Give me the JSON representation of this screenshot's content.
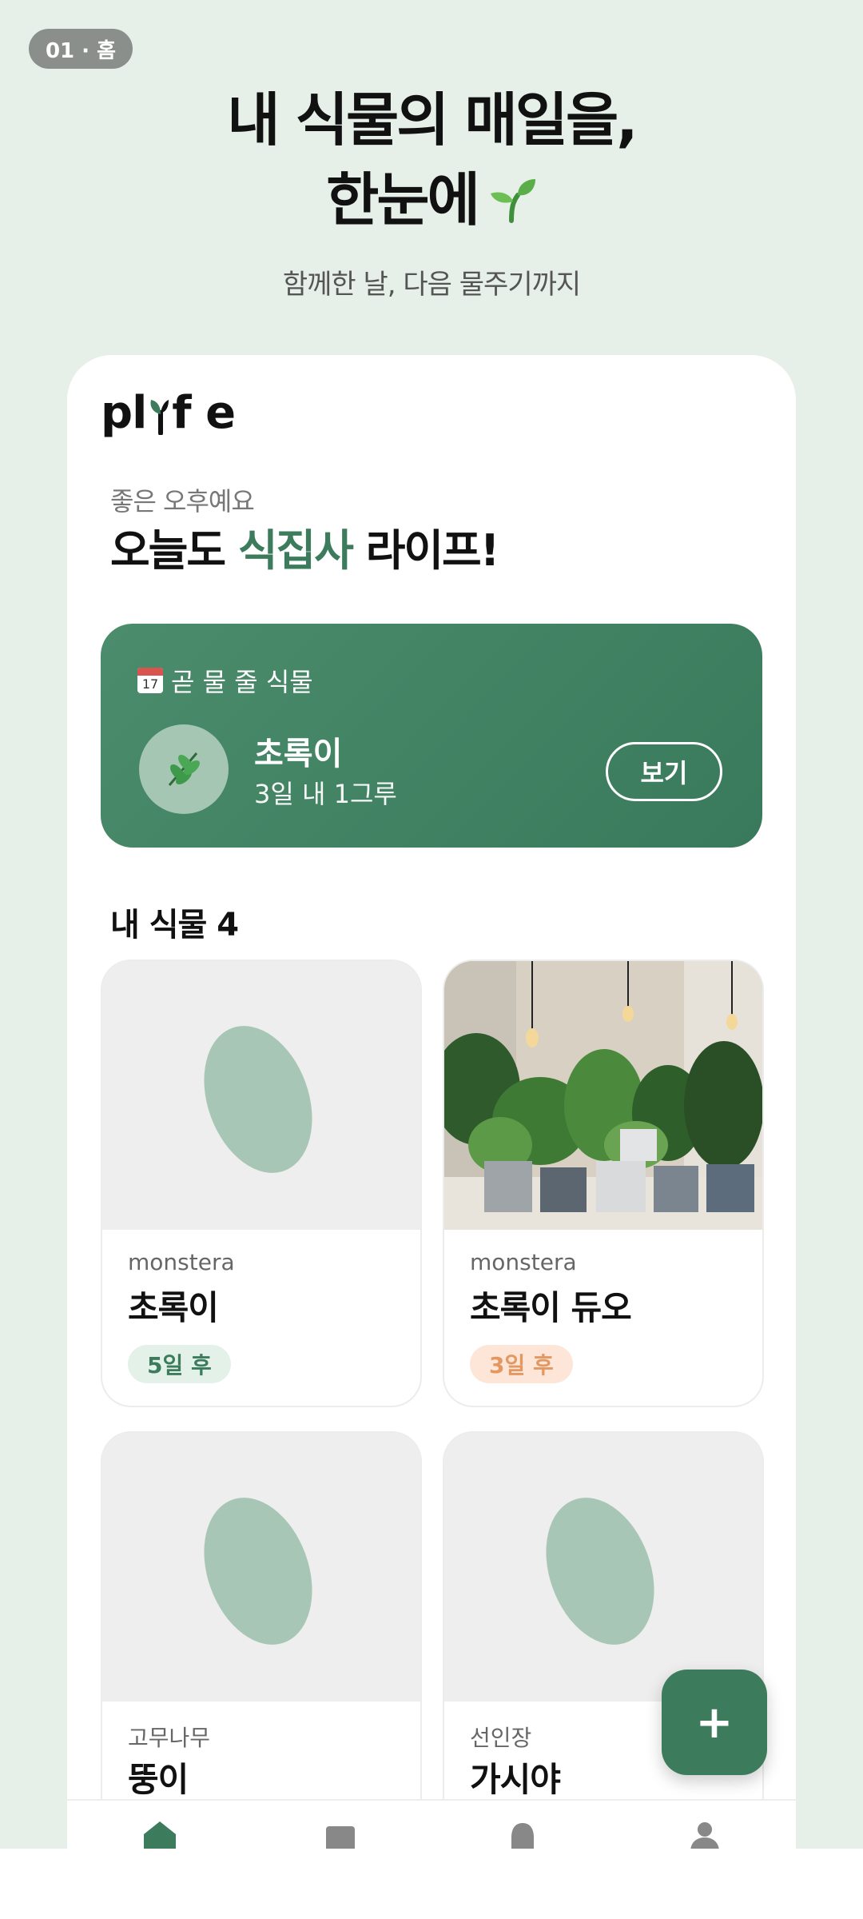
{
  "step_badge": "01 · 홈",
  "hero": {
    "title_line1": "내 식물의 매일을,",
    "title_line2": "한눈에",
    "subtitle": "함께한 날, 다음 물주기까지"
  },
  "app": {
    "logo": {
      "part1": "pl",
      "part2": "f e"
    },
    "greeting": "좋은 오후예요",
    "headline": {
      "before": "오늘도 ",
      "accent": "식집사",
      "after": " 라이프!"
    },
    "water_card": {
      "title": "곧 물 줄 식물",
      "calendar_number": "17",
      "plant_name": "초록이",
      "detail": "3일 내 1그루",
      "view_label": "보기"
    },
    "section_title": "내 식물 4",
    "plants": [
      {
        "species": "monstera",
        "name": "초록이",
        "badge": "5일 후",
        "badge_color": "green",
        "has_photo": false
      },
      {
        "species": "monstera",
        "name": "초록이 듀오",
        "badge": "3일 후",
        "badge_color": "orange",
        "has_photo": true
      },
      {
        "species": "고무나무",
        "name": "뚱이",
        "has_photo": false
      },
      {
        "species": "선인장",
        "name": "가시야",
        "has_photo": false
      }
    ],
    "fab_label": "+",
    "nav": [
      "home-icon",
      "library-icon",
      "bell-icon",
      "profile-icon"
    ]
  },
  "colors": {
    "accent": "#3c7c5c",
    "background": "#e6efe8",
    "badge_green_bg": "#e4f1e8",
    "badge_orange_bg": "#fde6d8",
    "badge_orange_text": "#e39862"
  }
}
